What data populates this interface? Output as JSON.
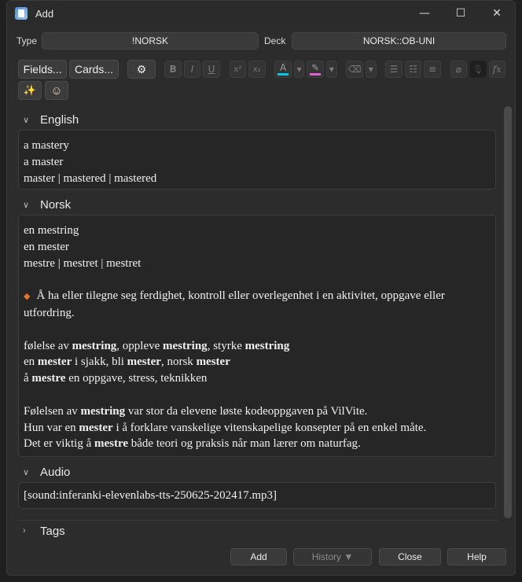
{
  "window": {
    "title": "Add",
    "controls": [
      "—",
      "☐",
      "✕"
    ]
  },
  "note_type": {
    "label": "Type",
    "value": "!NORSK"
  },
  "deck": {
    "label": "Deck",
    "value": "NORSK::OB-UNI"
  },
  "toolbar": {
    "fields_label": "Fields...",
    "cards_label": "Cards...",
    "gear_icon": "⚙",
    "bold": "B",
    "italic": "I",
    "underline": "U",
    "superscript": "x²",
    "subscript": "x₂",
    "text_color_glyph": "A",
    "highlight_glyph": "✎",
    "eraser_glyph": "⌫",
    "caret": "▾",
    "bullet_list": "☰",
    "numbered_list": "☷",
    "align": "≡",
    "attach": "⌀",
    "record": "🎙",
    "math": "fx",
    "sparkle": "✨",
    "face": "☺",
    "colors": {
      "text_color": "#00c8e6",
      "highlight": "#e060d0"
    }
  },
  "fields": [
    {
      "name": "English",
      "lines": [
        "a mastery",
        "a master",
        "master | mastered | mastered"
      ]
    },
    {
      "name": "Norsk",
      "lines": [
        "en mestring",
        "en mester",
        "mestre | mestret | mestret",
        "",
        "Å ha eller tilegne seg ferdighet, kontroll eller overlegenhet i en aktivitet, oppgave eller",
        "utfordring.",
        "",
        "følelse av mestring, oppleve mestring, styrke mestring",
        "en mester i sjakk, bli mester, norsk mester",
        "å mestre en oppgave, stress, teknikken",
        "",
        "Følelsen av mestring var stor da elevene løste kodeoppgaven på VilVite.",
        "Hun var en mester i å forklare vanskelige vitenskapelige konsepter på en enkel måte.",
        "Det er viktig å mestre både teori og praksis når man lærer om naturfag."
      ]
    },
    {
      "name": "Audio",
      "lines": [
        "[sound:inferanki-elevenlabs-tts-250625-202417.mp3]"
      ]
    }
  ],
  "tags": {
    "label": "Tags"
  },
  "buttons": {
    "add": "Add",
    "history": "History ▼",
    "close": "Close",
    "help": "Help"
  }
}
